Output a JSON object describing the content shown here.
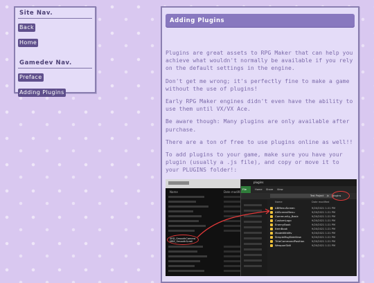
{
  "site_nav": {
    "heading": "Site Nav.",
    "links": [
      {
        "label": "Back"
      },
      {
        "label": "Home"
      }
    ],
    "gamedev_heading": "Gamedev Nav.",
    "gamedev_links": [
      {
        "label": "Preface"
      },
      {
        "label": "Adding Plugins"
      }
    ]
  },
  "content": {
    "title": "Adding Plugins",
    "paragraphs": [
      "Plugins are great assets to RPG Maker that can help you achieve what wouldn't normally be available if you rely on the default settings in the engine.",
      "Don't get me wrong; it's perfectly fine to make a game without the use of plugins!",
      "Early RPG Maker engines didn't even have the ability to use them until VX/VX Ace.",
      "Be aware though: Many plugins are only available after purchase.",
      "There are a ton of free to use plugins online as well!!",
      "To add plugins to your game, make sure you have your plugin (usually a .js file), and copy or move it to your PLUGINS folder!:"
    ]
  },
  "screenshot": {
    "window_title": "plugins",
    "ribbon_tabs": [
      "File",
      "Home",
      "Share",
      "View"
    ],
    "breadcrumb": [
      "Test Project",
      "js",
      "plugins"
    ],
    "left_column_header": "Name",
    "left_date_header": "Date modified",
    "left_highlight_files": [
      "SRD_SmoothCamera",
      "MBS_SmoothScroll"
    ],
    "right_column_name": "Name",
    "right_column_date": "Date modified",
    "files": [
      {
        "name": "ABMenuScreen",
        "date": "9/20/2021 1:21 PM"
      },
      {
        "name": "AltScreenMenu",
        "date": "9/20/2021 1:21 PM"
      },
      {
        "name": "Community_Basic",
        "date": "9/20/2021 1:21 PM"
      },
      {
        "name": "CustomLogo",
        "date": "9/20/2021 1:21 PM"
      },
      {
        "name": "EnemyBook",
        "date": "9/20/2021 1:21 PM"
      },
      {
        "name": "ItemBook",
        "date": "9/20/2021 1:21 PM"
      },
      {
        "name": "MadeWithMv",
        "date": "9/20/2021 1:21 PM"
      },
      {
        "name": "SimpleMsgSideView",
        "date": "9/20/2021 1:21 PM"
      },
      {
        "name": "TitleCommandPosition",
        "date": "9/20/2021 1:21 PM"
      },
      {
        "name": "WeaponSkill",
        "date": "9/20/2021 1:21 PM"
      }
    ],
    "annotation_color": "#e53a3a"
  },
  "colors": {
    "page_bg": "#d9c8f0",
    "panel_bg": "#e4dcf8",
    "title_bar": "#8878bf",
    "nav_link_bg": "#5f4f8c",
    "body_text": "#7b6aa9"
  }
}
